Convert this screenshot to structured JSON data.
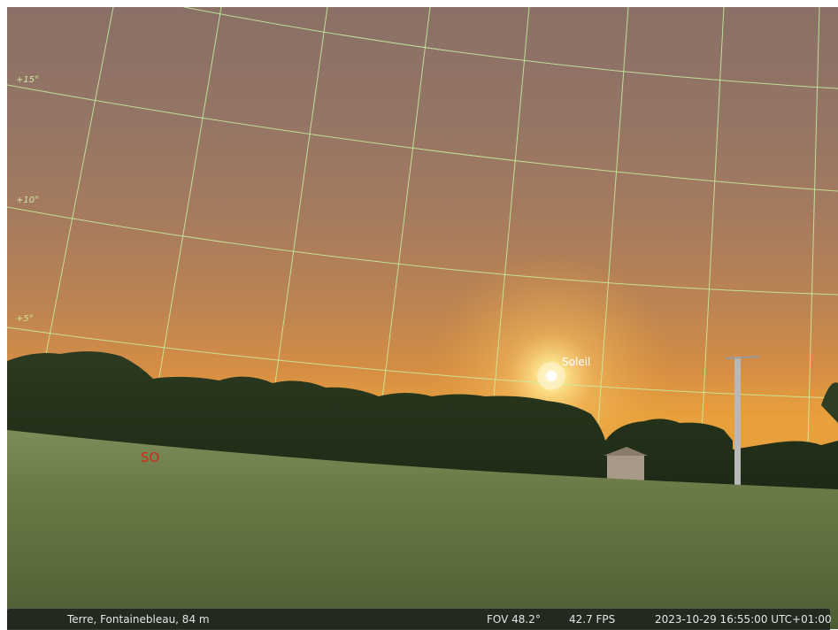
{
  "sky": {
    "altitude_labels": [
      "+15°",
      "+10°",
      "+5°"
    ],
    "sun_label": "Soleil",
    "cardinal_label": "SO"
  },
  "statusbar": {
    "location": "Terre, Fontainebleau, 84 m",
    "fov": "FOV 48.2°",
    "fps": "42.7 FPS",
    "datetime": "2023-10-29 16:55:00 UTC+01:00"
  },
  "colors": {
    "grid": "#c8f0a0",
    "cardinal": "#d0281c",
    "sun": "#ffffff"
  },
  "icons": {
    "sun": "sun-icon"
  }
}
